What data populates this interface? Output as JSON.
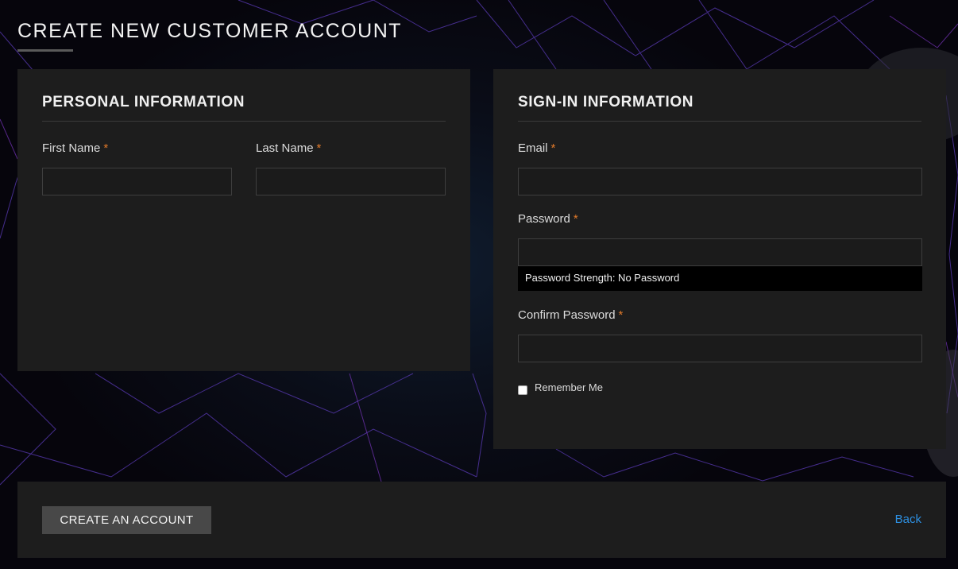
{
  "page": {
    "title": "CREATE NEW CUSTOMER ACCOUNT"
  },
  "personal": {
    "heading": "PERSONAL INFORMATION",
    "first_name_label": "First Name",
    "last_name_label": "Last Name",
    "required_mark": "*",
    "first_name_value": "",
    "last_name_value": ""
  },
  "signin": {
    "heading": "SIGN-IN INFORMATION",
    "email_label": "Email",
    "password_label": "Password",
    "confirm_password_label": "Confirm Password",
    "required_mark": "*",
    "email_value": "",
    "password_value": "",
    "confirm_password_value": "",
    "password_strength": "Password Strength: No Password",
    "remember_me_label": "Remember Me",
    "remember_me_checked": false
  },
  "actions": {
    "create_label": "CREATE AN ACCOUNT",
    "back_label": "Back"
  },
  "colors": {
    "accent_required": "#e0792a",
    "link": "#2d8fe0",
    "panel": "#1d1d1d"
  }
}
